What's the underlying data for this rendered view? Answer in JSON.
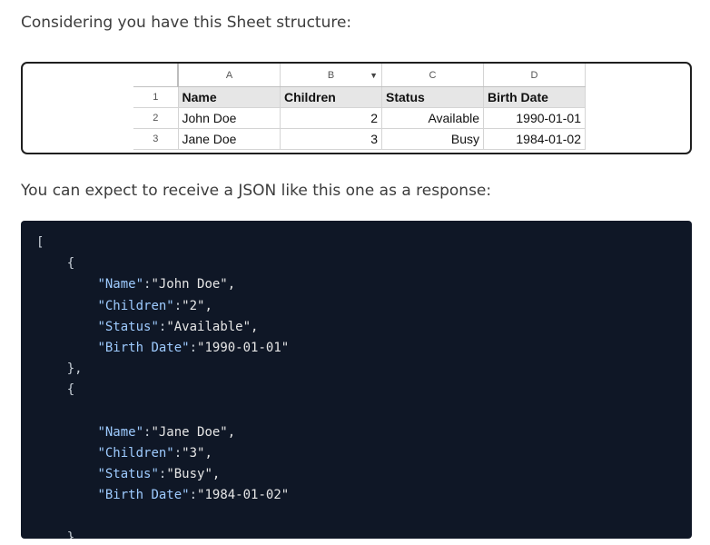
{
  "intro_text": "Considering you have this Sheet structure:",
  "response_text": "You can expect to receive a JSON like this one as a response:",
  "sheet": {
    "column_letters": [
      "A",
      "B",
      "C",
      "D"
    ],
    "filter_icon": "dropdown-arrow-icon",
    "rows": [
      {
        "row_number": "1",
        "cells": [
          "Name",
          "Children",
          "Status",
          "Birth Date"
        ]
      },
      {
        "row_number": "2",
        "cells": [
          "John Doe",
          "2",
          "Available",
          "1990-01-01"
        ]
      },
      {
        "row_number": "3",
        "cells": [
          "Jane Doe",
          "3",
          "Busy",
          "1984-01-02"
        ]
      }
    ]
  },
  "json_example": {
    "open_bracket": "[",
    "close_bracket": "]",
    "objects": [
      {
        "open": "{",
        "close": "},",
        "fields": [
          {
            "key": "\"Name\"",
            "value": "\"John Doe\","
          },
          {
            "key": "\"Children\"",
            "value": "\"2\","
          },
          {
            "key": "\"Status\"",
            "value": "\"Available\","
          },
          {
            "key": "\"Birth Date\"",
            "value": "\"1990-01-01\""
          }
        ]
      },
      {
        "open": "{",
        "close": "}",
        "fields": [
          {
            "key": "\"Name\"",
            "value": "\"Jane Doe\","
          },
          {
            "key": "\"Children\"",
            "value": "\"3\","
          },
          {
            "key": "\"Status\"",
            "value": "\"Busy\","
          },
          {
            "key": "\"Birth Date\"",
            "value": "\"1984-01-02\""
          }
        ]
      }
    ]
  },
  "colors": {
    "code_background": "#0f1726",
    "key_color": "#9ecbff"
  }
}
